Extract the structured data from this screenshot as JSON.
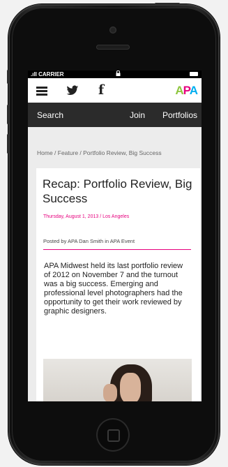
{
  "status_bar": {
    "carrier": ".ıll CARRIER",
    "lock_icon": "lock-icon",
    "battery_icon": "battery-icon"
  },
  "top_nav": {
    "menu_icon": "menu-icon",
    "twitter_icon": "twitter-icon",
    "facebook_glyph": "f",
    "logo": {
      "part1": "A",
      "part2": "P",
      "part3": "A"
    },
    "colors": {
      "green": "#8ec63f",
      "magenta": "#e6007e",
      "blue": "#00aeef"
    }
  },
  "sub_nav": {
    "search": "Search",
    "join": "Join",
    "portfolios": "Portfolios"
  },
  "breadcrumb": "Home  /  Feature  /  Portfolio Review, Big Success",
  "article": {
    "title": "Recap: Portfolio Review, Big Success",
    "date": "Thursday, August 1, 2013 / Los Angeles",
    "posted_by": "Posted by APA Dan Smith in APA Event",
    "body": "APA Midwest held its last portfolio review of 2012 on November 7 and the turnout was a big success. Emerging and professional level photographers had the opportunity to get their work reviewed by graphic designers."
  }
}
